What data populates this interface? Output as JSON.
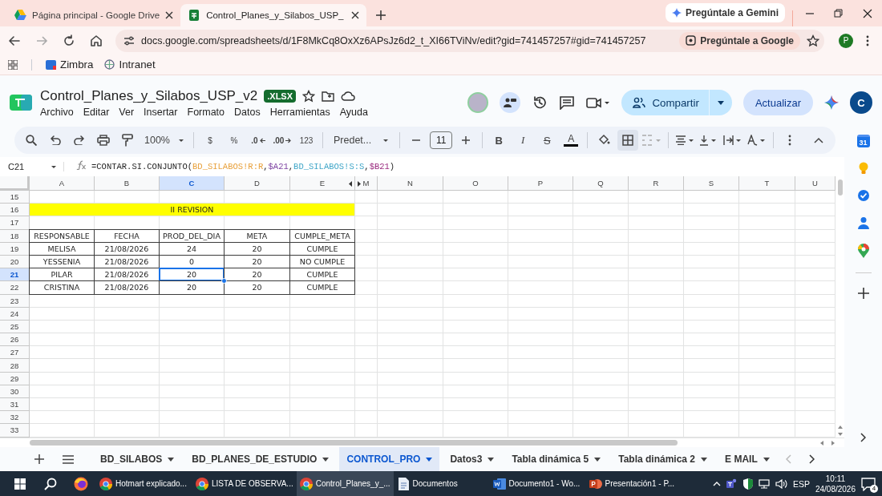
{
  "browser": {
    "tabs": [
      {
        "title": "Página principal - Google Drive",
        "selected": false,
        "kind": "drive"
      },
      {
        "title": "Control_Planes_y_Silabos_USP_ ",
        "selected": true,
        "kind": "sheets"
      }
    ],
    "gemini_button": "Pregúntale a Gemini",
    "url": "docs.google.com/spreadsheets/d/1F8MkCq8OxXz6APsJz6d2_t_XI66TViNv/edit?gid=741457257#gid=741457257",
    "ask_google": "Pregúntale a Google",
    "profile": "P",
    "bookmarks": [
      {
        "label": "Zimbra",
        "kind": "zimbra"
      },
      {
        "label": "Intranet",
        "kind": "intranet"
      }
    ]
  },
  "sheets": {
    "title": "Control_Planes_y_Silabos_USP_v2",
    "badge": ".XLSX",
    "menu": [
      "Archivo",
      "Editar",
      "Ver",
      "Insertar",
      "Formato",
      "Datos",
      "Herramientas",
      "Ayuda"
    ],
    "share": "Compartir",
    "update": "Actualizar",
    "account": "C",
    "toolbar": {
      "zoom": "100%",
      "currency": "$",
      "percent": "%",
      "decrease_decimals": ".0",
      "increase_decimals": ".00",
      "number_format": "123",
      "font": "Predet...",
      "font_size": "11",
      "bold": "B",
      "italic": "I",
      "strike": "S",
      "text_color": "A",
      "borders_selected": true
    },
    "cell_ref": "C21",
    "formula": [
      {
        "text": "=CONTAR.SI.CONJUNTO("
      },
      {
        "text": "BD_SILABOS!R:R",
        "color": "#e8a03a"
      },
      {
        "text": ","
      },
      {
        "text": "$A21",
        "color": "#7b3fa0"
      },
      {
        "text": ","
      },
      {
        "text": "BD_SILABOS!S:S",
        "color": "#3fa6c8"
      },
      {
        "text": ","
      },
      {
        "text": "$B21",
        "color": "#9a2a7e"
      },
      {
        "text": ")"
      }
    ],
    "columns": [
      {
        "label": "A",
        "selected": false
      },
      {
        "label": "B",
        "selected": false
      },
      {
        "label": "C",
        "selected": true
      },
      {
        "label": "D",
        "selected": false
      },
      {
        "label": "E",
        "selected": false
      },
      {
        "label": "M",
        "selected": false
      },
      {
        "label": "N",
        "selected": false
      },
      {
        "label": "O",
        "selected": false
      },
      {
        "label": "P",
        "selected": false
      },
      {
        "label": "Q",
        "selected": false
      },
      {
        "label": "R",
        "selected": false
      },
      {
        "label": "S",
        "selected": false
      },
      {
        "label": "T",
        "selected": false
      },
      {
        "label": "U",
        "selected": false
      }
    ],
    "rows": [
      {
        "number": "15",
        "selected": false
      },
      {
        "number": "16",
        "selected": false,
        "banner": {
          "text": "II REVISION",
          "color": "#ffff00"
        }
      },
      {
        "number": "17",
        "selected": false
      },
      {
        "number": "18",
        "selected": false,
        "cells": [
          {
            "text": "RESPONSABLE",
            "selected": false
          },
          {
            "text": "FECHA",
            "selected": false
          },
          {
            "text": "PROD_DEL_DIA",
            "selected": false
          },
          {
            "text": "META",
            "selected": false
          },
          {
            "text": "CUMPLE_META",
            "selected": false
          }
        ]
      },
      {
        "number": "19",
        "selected": false,
        "cells": [
          {
            "text": "MELISA",
            "selected": false
          },
          {
            "text": "21/08/2026",
            "selected": false
          },
          {
            "text": "24",
            "selected": false
          },
          {
            "text": "20",
            "selected": false
          },
          {
            "text": "CUMPLE",
            "selected": false
          }
        ]
      },
      {
        "number": "20",
        "selected": false,
        "cells": [
          {
            "text": "YESSENIA",
            "selected": false
          },
          {
            "text": "21/08/2026",
            "selected": false
          },
          {
            "text": "0",
            "selected": false
          },
          {
            "text": "20",
            "selected": false
          },
          {
            "text": "NO CUMPLE",
            "selected": false
          }
        ]
      },
      {
        "number": "21",
        "selected": true,
        "cells": [
          {
            "text": "PILAR",
            "selected": false
          },
          {
            "text": "21/08/2026",
            "selected": false
          },
          {
            "text": "20",
            "selected": true
          },
          {
            "text": "20",
            "selected": false
          },
          {
            "text": "CUMPLE",
            "selected": false
          }
        ]
      },
      {
        "number": "22",
        "selected": false,
        "cells": [
          {
            "text": "CRISTINA",
            "selected": false
          },
          {
            "text": "21/08/2026",
            "selected": false
          },
          {
            "text": "20",
            "selected": false
          },
          {
            "text": "20",
            "selected": false
          },
          {
            "text": "CUMPLE",
            "selected": false
          }
        ]
      },
      {
        "number": "23",
        "selected": false
      },
      {
        "number": "24",
        "selected": false
      },
      {
        "number": "25",
        "selected": false
      },
      {
        "number": "26",
        "selected": false
      },
      {
        "number": "27",
        "selected": false
      },
      {
        "number": "28",
        "selected": false
      },
      {
        "number": "29",
        "selected": false
      },
      {
        "number": "30",
        "selected": false
      },
      {
        "number": "31",
        "selected": false
      },
      {
        "number": "32",
        "selected": false
      },
      {
        "number": "33",
        "selected": false
      }
    ],
    "sheet_tabs": [
      {
        "label": "BD_SILABOS",
        "selected": false
      },
      {
        "label": "BD_PLANES_DE_ESTUDIO",
        "selected": false
      },
      {
        "label": "CONTROL_PRO",
        "selected": true
      },
      {
        "label": "Datos3",
        "selected": false
      },
      {
        "label": "Tabla dinámica 5",
        "selected": false
      },
      {
        "label": "Tabla dinámica 2",
        "selected": false
      },
      {
        "label": "E MAIL",
        "selected": false
      }
    ],
    "side_panel": {
      "calendar": "31"
    }
  },
  "taskbar": {
    "apps": [
      {
        "label": "Hotmart explicado...",
        "kind": "chrome",
        "selected": false
      },
      {
        "label": "LISTA DE OBSERVA...",
        "kind": "chrome",
        "selected": false
      },
      {
        "label": "Control_Planes_y_...",
        "kind": "chrome",
        "selected": true
      },
      {
        "label": "Documentos",
        "kind": "doc",
        "selected": false
      },
      {
        "label": "Documento1 - Wo...",
        "kind": "word",
        "selected": false
      },
      {
        "label": "Presentación1 - P...",
        "kind": "powerpoint",
        "selected": false
      }
    ],
    "language": "ESP",
    "time": "10:11",
    "date": "24/08/2026",
    "notifications": "4"
  }
}
